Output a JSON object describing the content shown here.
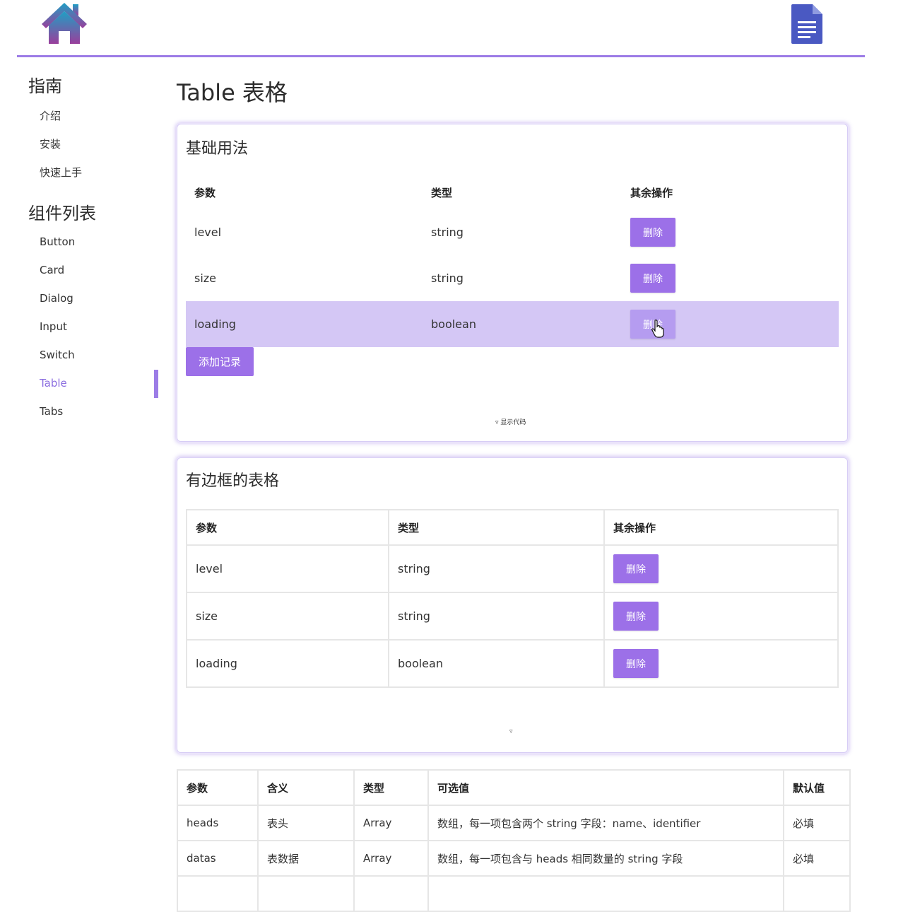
{
  "header": {
    "home_icon": "home-icon",
    "doc_icon": "document-icon",
    "accent": "#9c7ce6"
  },
  "sidebar": {
    "groups": [
      {
        "title": "指南",
        "items": [
          "介绍",
          "安装",
          "快速上手"
        ]
      },
      {
        "title": "组件列表",
        "items": [
          "Button",
          "Card",
          "Dialog",
          "Input",
          "Switch",
          "Table",
          "Tabs"
        ]
      }
    ],
    "active_item": "Table"
  },
  "page": {
    "title": "Table 表格"
  },
  "demo_basic": {
    "title": "基础用法",
    "headers": [
      "参数",
      "类型",
      "其余操作"
    ],
    "rows": [
      {
        "param": "level",
        "type": "string",
        "action": "删除"
      },
      {
        "param": "size",
        "type": "string",
        "action": "删除"
      },
      {
        "param": "loading",
        "type": "boolean",
        "action": "删除"
      }
    ],
    "add_label": "添加记录",
    "show_code": "▿ 显示代码"
  },
  "demo_bordered": {
    "title": "有边框的表格",
    "headers": [
      "参数",
      "类型",
      "其余操作"
    ],
    "rows": [
      {
        "param": "level",
        "type": "string",
        "action": "删除"
      },
      {
        "param": "size",
        "type": "string",
        "action": "删除"
      },
      {
        "param": "loading",
        "type": "boolean",
        "action": "删除"
      }
    ],
    "toggle": "▿"
  },
  "api_table": {
    "headers": [
      "参数",
      "含义",
      "类型",
      "可选值",
      "默认值"
    ],
    "rows": [
      [
        "heads",
        "表头",
        "Array",
        "数组，每一项包含两个 string 字段：name、identifier",
        "必填"
      ],
      [
        "datas",
        "表数据",
        "Array",
        "数组，每一项包含与 heads 相同数量的 string 字段",
        "必填"
      ]
    ]
  },
  "colors": {
    "primary_button": "#9c70e8",
    "row_highlight": "#d4c7f5",
    "active_link": "#8c6fe0"
  }
}
